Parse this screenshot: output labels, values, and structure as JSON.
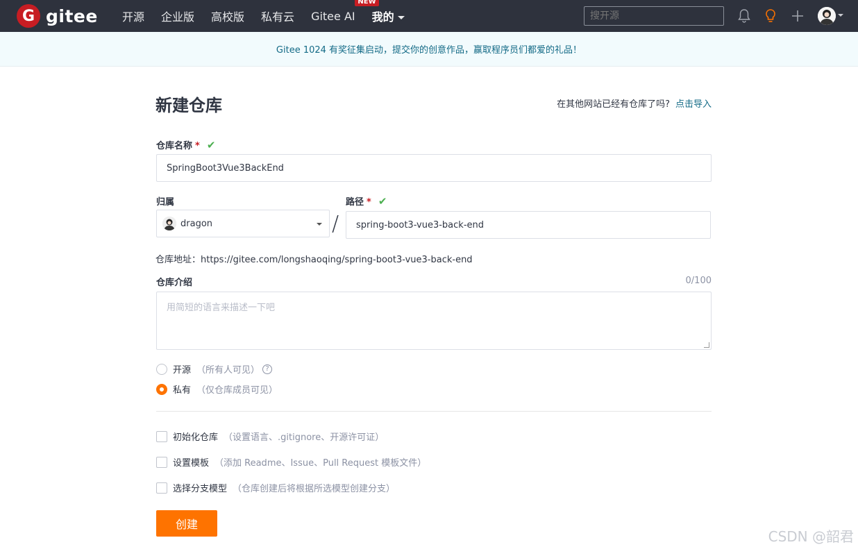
{
  "nav": {
    "logo_letter": "G",
    "logo_text": "gitee",
    "items": [
      {
        "label": "开源"
      },
      {
        "label": "企业版"
      },
      {
        "label": "高校版"
      },
      {
        "label": "私有云"
      },
      {
        "label": "Gitee AI",
        "badge": "NEW"
      },
      {
        "label": "我的"
      }
    ],
    "search_placeholder": "搜开源",
    "icons": [
      "bell-icon",
      "lightbulb-icon",
      "plus-icon"
    ],
    "accent_color": "#c71d23"
  },
  "banner": {
    "text": "Gitee 1024 有奖征集启动，提交你的创意作品，赢取程序员们都爱的礼品！"
  },
  "form": {
    "title": "新建仓库",
    "import_hint": "在其他网站已经有仓库了吗?",
    "import_link": "点击导入",
    "repo_name_label": "仓库名称",
    "repo_name_value": "SpringBoot3Vue3BackEnd",
    "owner_label": "归属",
    "owner_value": "dragon",
    "path_label": "路径",
    "path_value": "spring-boot3-vue3-back-end",
    "required_mark": "*",
    "slash": "/",
    "repo_url": "仓库地址：https://gitee.com/longshaoqing/spring-boot3-vue3-back-end",
    "desc_label": "仓库介绍",
    "desc_counter": "0/100",
    "desc_placeholder": "用简短的语言来描述一下吧",
    "visibility": {
      "open_label": "开源",
      "open_hint": "（所有人可见）",
      "private_label": "私有",
      "private_hint": "（仅仓库成员可见）",
      "selected": "private"
    },
    "options": [
      {
        "label": "初始化仓库",
        "hint": "（设置语言、.gitignore、开源许可证）",
        "checked": false
      },
      {
        "label": "设置模板",
        "hint": "（添加 Readme、Issue、Pull Request 模板文件）",
        "checked": false
      },
      {
        "label": "选择分支模型",
        "hint": "（仓库创建后将根据所选模型创建分支）",
        "checked": false
      }
    ],
    "submit_label": "创建",
    "submit_color": "#fe7300"
  },
  "watermark": "CSDN @韶君"
}
